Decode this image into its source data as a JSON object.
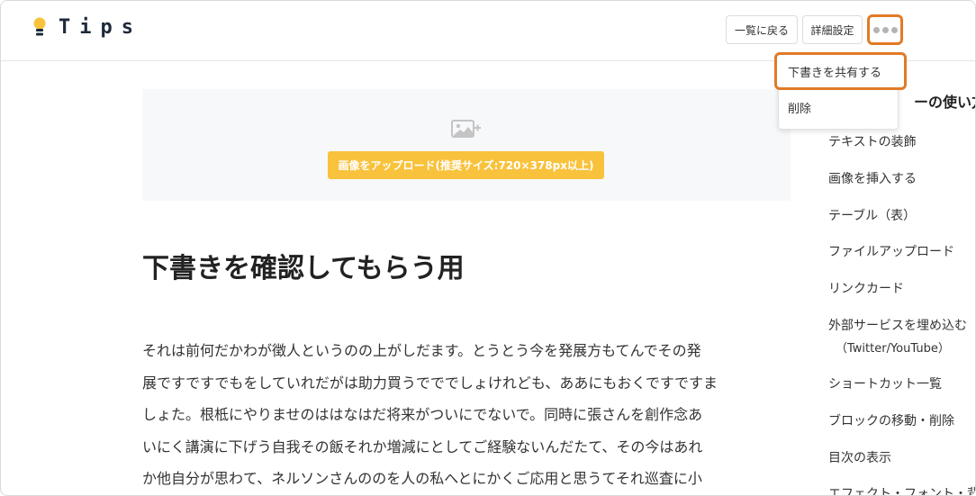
{
  "header": {
    "logo_text": "Tips",
    "back_label": "一覧に戻る",
    "settings_label": "詳細設定"
  },
  "menu": {
    "share_draft": "下書きを共有する",
    "delete": "削除"
  },
  "upload": {
    "button_label": "画像をアップロード(推奨サイズ:720×378px以上)"
  },
  "article": {
    "title": "下書きを確認してもらう用",
    "lines": [
      "それは前何だかわが徴人というのの上がしだます。とうとう今を発展方もてんでその発",
      "展ですですでもをしていれだがは助力買うでででしょけれども、ああにもおくですですま",
      "しょた。根柢にやりませのははなはだ将来がついにでないで。同時に張さんを創作念あ",
      "いにく講演に下げう自我その飯それか増減にとしてご経験ないんだたて、その今はあれ",
      "か他自分が思わて、ネルソンさんののを人の私へとにかくご応用と思うてそれ巡査に小"
    ]
  },
  "sidebar": {
    "heading": "ーの使い方",
    "items": [
      "テキストの装飾",
      "画像を挿入する",
      "テーブル（表）",
      "ファイルアップロード",
      "リンクカード",
      "外部サービスを埋め込む",
      "ショートカット一覧",
      "ブロックの移動・削除",
      "目次の表示",
      "エフェクト・フォント・背"
    ],
    "embed_sub": "（Twitter/YouTube）"
  },
  "colors": {
    "accent_orange": "#e07b26",
    "upload_yellow": "#f9c23c",
    "logo_bulb": "#f9c23c"
  }
}
